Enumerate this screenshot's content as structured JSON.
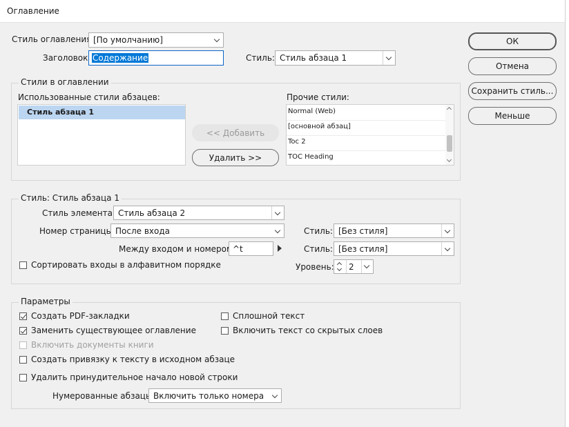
{
  "window": {
    "title": "Оглавление"
  },
  "toc_style": {
    "label": "Стиль оглавления:",
    "value": "[По умолчанию]"
  },
  "heading": {
    "label": "Заголовок:",
    "value": "Содержание",
    "style_label": "Стиль:",
    "style_value": "Стиль абзаца 1"
  },
  "buttons": {
    "ok": "ОК",
    "cancel": "Отмена",
    "save_style": "Сохранить стиль...",
    "less": "Меньше"
  },
  "toc_styles": {
    "group_title": "Стили в оглавлении",
    "used_label": "Использованные стили абзацев:",
    "used_items": [
      "Стиль абзаца 1"
    ],
    "add": "<< Добавить",
    "remove": "Удалить >>",
    "other_label": "Прочие стили:",
    "other_items": [
      "Normal (Web)",
      "[основной абзац]",
      "Toc 2",
      "TOC Heading"
    ]
  },
  "style_section": {
    "group_title": "Стиль: Стиль абзаца 1",
    "entry_style_label": "Стиль элемента:",
    "entry_style_value": "Стиль абзаца 2",
    "page_number_label": "Номер страницы:",
    "page_number_value": "После входа",
    "style_label_1": "Стиль:",
    "style_value_1": "[Без стиля]",
    "between_label": "Между входом и номером:",
    "between_value": "^t",
    "style_label_2": "Стиль:",
    "style_value_2": "[Без стиля]",
    "sort_label": "Сортировать входы в алфавитном порядке",
    "level_label": "Уровень:",
    "level_value": "2"
  },
  "options": {
    "group_title": "Параметры",
    "create_pdf": "Создать PDF-закладки",
    "replace_existing": "Заменить существующее оглавление",
    "include_book": "Включить документы книги",
    "create_anchor": "Создать привязку к тексту в исходном абзаце",
    "remove_breaks": "Удалить принудительное начало новой строки",
    "run_in": "Сплошной текст",
    "hidden_layers": "Включить текст со скрытых слоев",
    "numbered_label": "Нумерованные абзацы:",
    "numbered_value": "Включить только номера"
  }
}
